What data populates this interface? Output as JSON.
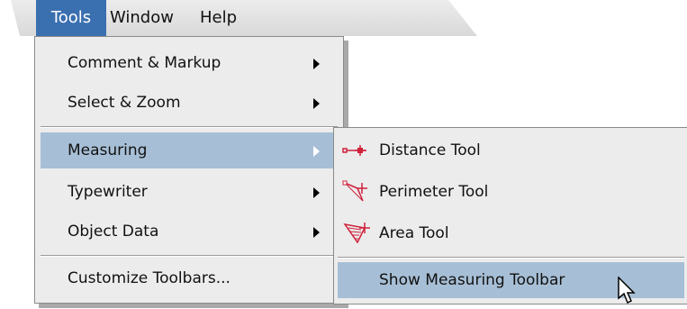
{
  "menubar": {
    "items": [
      {
        "label": "Tools"
      },
      {
        "label": "Window"
      },
      {
        "label": "Help"
      }
    ]
  },
  "tools_menu": {
    "items": [
      {
        "label": "Comment & Markup",
        "has_submenu": true
      },
      {
        "label": "Select & Zoom",
        "has_submenu": true
      },
      {
        "label": "Measuring",
        "has_submenu": true,
        "highlighted": true
      },
      {
        "label": "Typewriter",
        "has_submenu": true
      },
      {
        "label": "Object Data",
        "has_submenu": true
      },
      {
        "label": "Customize Toolbars..."
      }
    ]
  },
  "measuring_submenu": {
    "items": [
      {
        "label": "Distance Tool",
        "icon": "distance-tool-icon"
      },
      {
        "label": "Perimeter Tool",
        "icon": "perimeter-tool-icon"
      },
      {
        "label": "Area Tool",
        "icon": "area-tool-icon"
      },
      {
        "label": "Show Measuring Toolbar",
        "highlighted": true
      }
    ]
  },
  "colors": {
    "menubar_highlight": "#3a6fb0",
    "item_highlight": "#a7bfd6",
    "menu_background": "#ececec",
    "icon_accent": "#d0203a"
  }
}
